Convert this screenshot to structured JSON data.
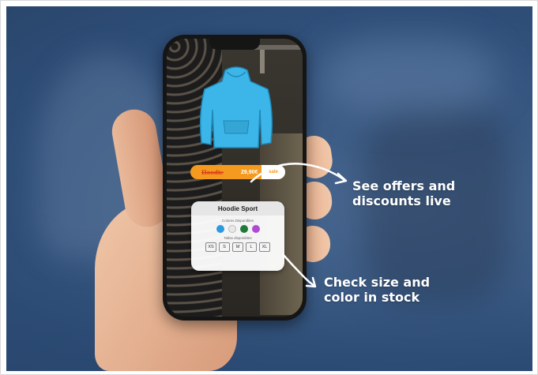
{
  "callouts": {
    "offers_line1": "See offers and",
    "offers_line2": "discounts live",
    "stock_line1": "Check size and",
    "stock_line2": "color in stock"
  },
  "ar_price_tag": {
    "old_price_label": "Hoodie",
    "new_price": "29,90€",
    "button_label": "sale"
  },
  "product_card": {
    "title": "Hoodie Sport",
    "colors_label": "Colores Disponibles",
    "colors": [
      "#2b9ae0",
      "#e8e8e8",
      "#1f7a3a",
      "#b14ad3"
    ],
    "sizes_label": "Tallas disponibles",
    "sizes": [
      "XS",
      "S",
      "M",
      "L",
      "XL"
    ]
  },
  "colors": {
    "hoodie": "#3cb6e8",
    "tag_orange": "#f39a1f",
    "callout_text": "#ffffff"
  }
}
